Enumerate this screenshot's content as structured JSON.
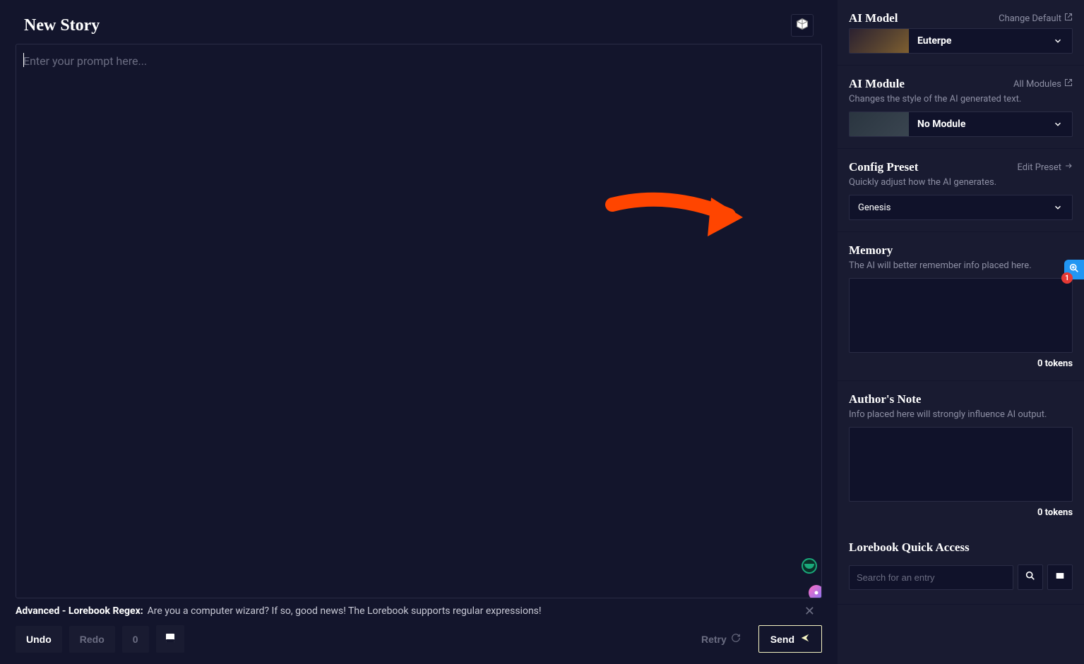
{
  "header": {
    "title": "New Story",
    "dice_icon": "dice-icon"
  },
  "editor": {
    "placeholder": "Enter your prompt here..."
  },
  "tip": {
    "lead": "Advanced - Lorebook Regex:",
    "message": "Are you a computer wizard? If so, good news! The Lorebook supports regular expressions!"
  },
  "toolbar": {
    "undo": "Undo",
    "redo": "Redo",
    "count": "0",
    "retry": "Retry",
    "send": "Send"
  },
  "sidebar": {
    "model": {
      "title": "AI Model",
      "link": "Change Default",
      "selected": "Euterpe"
    },
    "module": {
      "title": "AI Module",
      "link": "All Modules",
      "desc": "Changes the style of the AI generated text.",
      "selected": "No Module"
    },
    "preset": {
      "title": "Config Preset",
      "link": "Edit Preset",
      "desc": "Quickly adjust how the AI generates.",
      "selected": "Genesis"
    },
    "memory": {
      "title": "Memory",
      "desc": "The AI will better remember info placed here.",
      "tokens": "0 tokens"
    },
    "author": {
      "title": "Author's Note",
      "desc": "Info placed here will strongly influence AI output.",
      "tokens": "0 tokens"
    },
    "lorebook": {
      "title": "Lorebook Quick Access",
      "search_placeholder": "Search for an entry"
    }
  },
  "widget": {
    "badge": "1"
  }
}
